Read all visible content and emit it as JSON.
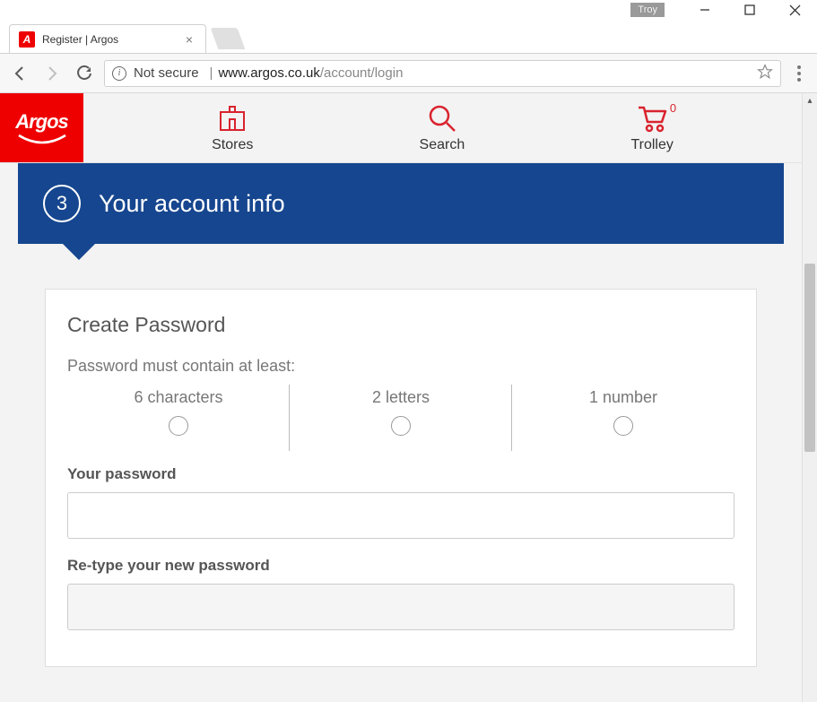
{
  "window": {
    "user_badge": "Troy"
  },
  "browser": {
    "tab_title": "Register | Argos",
    "secure_label": "Not secure",
    "url_host": "www.argos.co.uk",
    "url_path": "/account/login"
  },
  "header": {
    "brand": "Argos",
    "nav": {
      "stores": "Stores",
      "search": "Search",
      "trolley": "Trolley",
      "trolley_count": "0"
    }
  },
  "step": {
    "number": "3",
    "title": "Your account info"
  },
  "form": {
    "card_title": "Create Password",
    "req_intro": "Password must contain at least:",
    "req1": "6 characters",
    "req2": "2 letters",
    "req3": "1 number",
    "pw_label": "Your password",
    "pw_value": "",
    "pw2_label": "Re-type your new password",
    "pw2_value": ""
  }
}
